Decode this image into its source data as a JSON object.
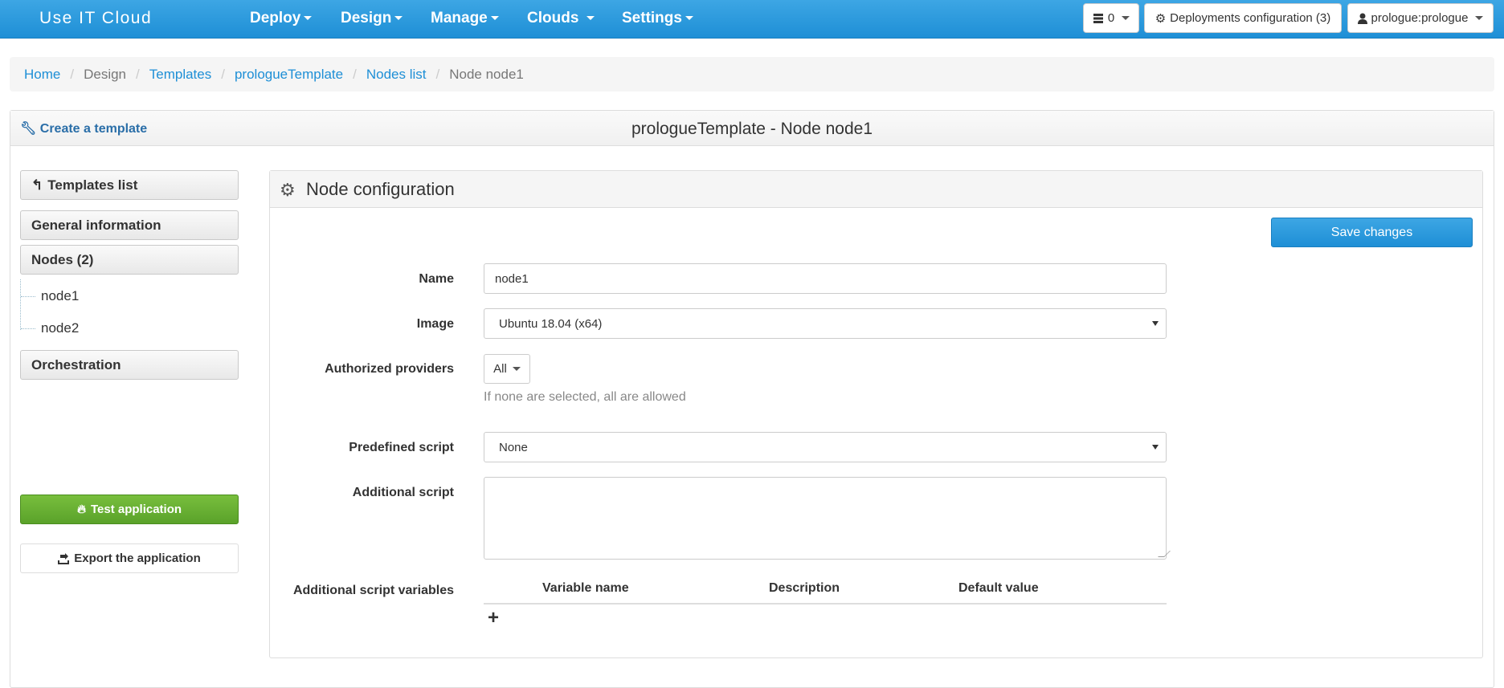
{
  "navbar": {
    "brand": "Use IT Cloud",
    "menus": [
      {
        "label": "Deploy"
      },
      {
        "label": "Design"
      },
      {
        "label": "Manage"
      },
      {
        "label": "Clouds"
      },
      {
        "label": "Settings"
      }
    ],
    "counter_label": "0",
    "deployments_label": "Deployments configuration (3)",
    "user_label": "prologue:prologue"
  },
  "breadcrumb": {
    "home": "Home",
    "design": "Design",
    "templates": "Templates",
    "template": "prologueTemplate",
    "nodes_list": "Nodes list",
    "current": "Node node1"
  },
  "panel": {
    "create_link": "Create a template",
    "title": "prologueTemplate - Node node1"
  },
  "sidebar": {
    "templates_list": "Templates list",
    "general_information": "General information",
    "nodes": "Nodes (2)",
    "node_items": [
      "node1",
      "node2"
    ],
    "orchestration": "Orchestration",
    "test_application": "Test application",
    "export_application": "Export the application"
  },
  "node_config": {
    "title": "Node configuration",
    "save_label": "Save changes",
    "name_label": "Name",
    "name_value": "node1",
    "image_label": "Image",
    "image_value": "Ubuntu 18.04 (x64)",
    "providers_label": "Authorized providers",
    "providers_value": "All",
    "providers_help": "If none are selected, all are allowed",
    "predefined_label": "Predefined script",
    "predefined_value": "None",
    "additional_label": "Additional script",
    "additional_value": "",
    "variables_label": "Additional script variables",
    "variables_columns": [
      "Variable name",
      "Description",
      "Default value"
    ],
    "add_symbol": "+"
  },
  "colors": {
    "navbar": "#1e8fd6",
    "link": "#1e8fd6",
    "success": "#5aa22a"
  }
}
